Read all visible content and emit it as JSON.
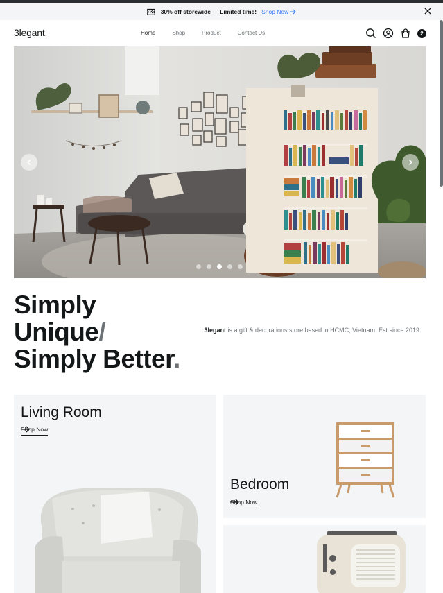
{
  "promo": {
    "message": "30% off storewide — Limited time!",
    "link_label": "Shop Now"
  },
  "nav": {
    "logo": "3legant",
    "logo_dot": ".",
    "menu": [
      "Home",
      "Shop",
      "Product",
      "Contact Us"
    ],
    "active": "Home",
    "cart_count": "2"
  },
  "hero": {
    "slides": 5,
    "active_slide": 3
  },
  "headline": {
    "line1": "Simply",
    "line2": "Unique",
    "slash": "/",
    "line3": "Simply Better",
    "period": "."
  },
  "description": {
    "brand": "3legant",
    "text": " is a gift & decorations store based in HCMC, Vietnam. Est since 2019."
  },
  "categories": [
    {
      "title": "Living Room",
      "link": "Shop Now"
    },
    {
      "title": "Bedroom",
      "link": "Shop Now"
    },
    {
      "title": "",
      "link": ""
    }
  ],
  "colors": {
    "accent": "#377dff",
    "text": "#141718",
    "muted": "#6c7275",
    "card_bg": "#f3f5f7"
  },
  "icons": [
    "ticket-percent-icon",
    "arrow-right-icon",
    "close-icon",
    "search-icon",
    "user-circle-icon",
    "shopping-bag-icon",
    "chevron-left-icon",
    "chevron-right-icon"
  ]
}
